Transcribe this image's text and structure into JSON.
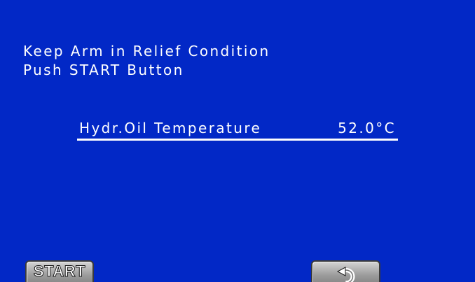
{
  "instructions": {
    "line1": "Keep Arm in Relief Condition",
    "line2": "Push START Button"
  },
  "reading": {
    "label": "Hydr.Oil Temperature",
    "value": "52.0°C"
  },
  "buttons": {
    "start_label": "START",
    "back_icon": "return-arrow-icon"
  },
  "colors": {
    "background": "#0228c6",
    "text": "#ffffff",
    "button_face": "#9a9a9a"
  }
}
